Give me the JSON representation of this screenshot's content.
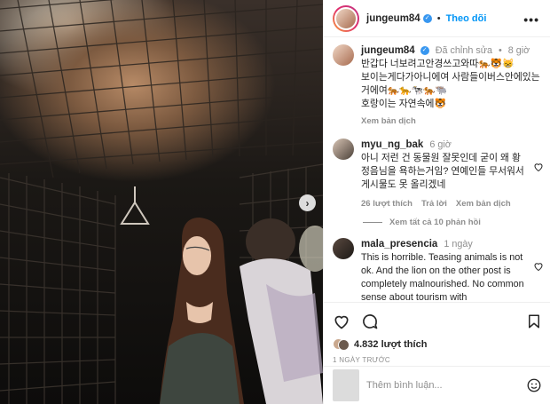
{
  "post": {
    "username": "jungeum84",
    "follow_label": "Theo dõi",
    "separator": "•",
    "more_label": "•••",
    "caption": {
      "edited_label": "Đã chỉnh sửa",
      "separator": "•",
      "time": "8 giờ",
      "line1": "반갑다 너보려고안경쓰고와따🐅🐯😸",
      "line2": "보이는게다가아니에여 사람들이버스안에있는거에여🐅🐆🐄🐅🐃",
      "line3": "호랑이는 자연속에🐯",
      "translate_label": "Xem bản dịch"
    },
    "comments": [
      {
        "username": "myu_ng_bak",
        "time": "6 giờ",
        "text": "아니 저런 건 동물원 잘못인데 굳이 왜 황정음님을 욕하는거임? 연예인들 무서워서 게시물도 못 올리겠네",
        "likes": "26 lượt thích",
        "reply_label": "Trả lời",
        "translate_label": "Xem bản dịch"
      },
      {
        "username": "mala_presencia",
        "time": "1 ngày",
        "text": "This is horrible. Teasing animals is not ok. And the lion on the other post is completely malnourished. No common sense about tourism with"
      }
    ],
    "view_replies_label": "Xem tất cả 10 phản hồi",
    "like_count": "4.832 lượt thích",
    "posted_ago": "1 NGÀY TRƯỚC",
    "comment_placeholder": "Thêm bình luận..."
  },
  "carousel": {
    "next_label": "›"
  },
  "colors": {
    "link": "#0095f6",
    "muted": "#8e8e8e",
    "verified": "#3897f0"
  }
}
